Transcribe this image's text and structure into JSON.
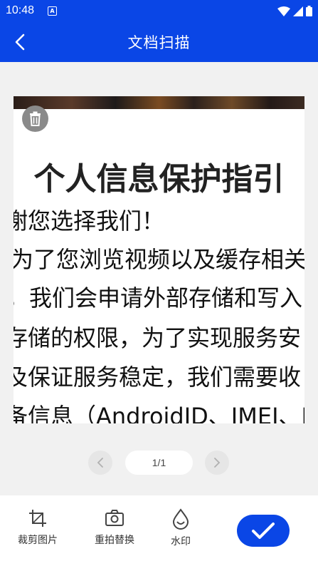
{
  "status_bar": {
    "time": "10:48",
    "notification_icon": "A"
  },
  "app_bar": {
    "title": "文档扫描",
    "back_icon": "chevron-left-icon"
  },
  "document": {
    "title": "个人信息保护指引",
    "lines": [
      "谢您选择我们！",
      "为了您浏览视频以及缓存相关",
      "，我们会申请外部存储和写入",
      "存储的权限，为了实现服务安",
      "及保证服务稳定，我们需要收",
      "备信息（AndroidID、IMEI、M"
    ]
  },
  "pager": {
    "counter": "1/1"
  },
  "toolbar": {
    "crop_label": "裁剪图片",
    "retake_label": "重拍替换",
    "watermark_label": "水印"
  },
  "colors": {
    "brand": "#0a46e6"
  }
}
